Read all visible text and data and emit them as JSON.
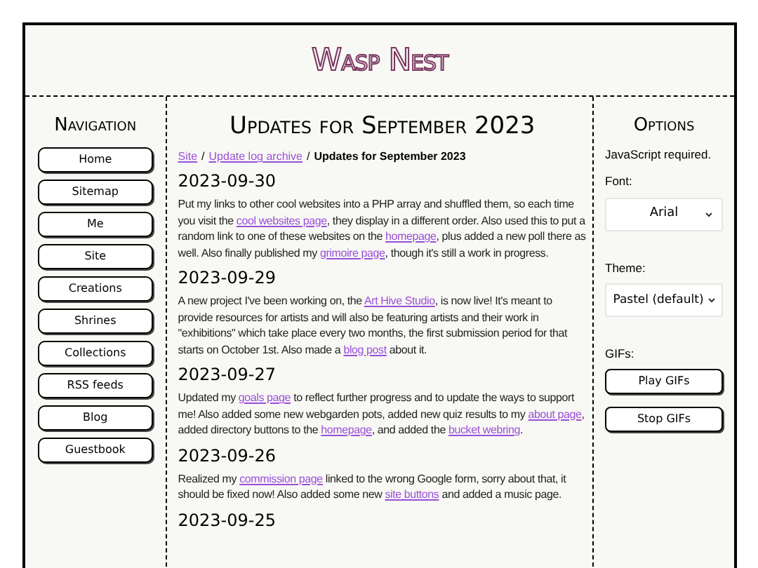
{
  "site_title": "Wasp Nest",
  "navigation": {
    "heading": "Navigation",
    "items": [
      "Home",
      "Sitemap",
      "Me",
      "Site",
      "Creations",
      "Shrines",
      "Collections",
      "RSS feeds",
      "Blog",
      "Guestbook"
    ]
  },
  "main": {
    "heading": "Updates for September 2023",
    "breadcrumb": [
      {
        "kind": "link",
        "text": "Site"
      },
      {
        "kind": "separator",
        "text": "/"
      },
      {
        "kind": "link",
        "text": "Update log archive"
      },
      {
        "kind": "separator",
        "text": "/"
      },
      {
        "kind": "current",
        "text": "Updates for September 2023"
      }
    ],
    "entries": [
      {
        "date": "2023-09-30",
        "body": [
          {
            "t": "Put my links to other cool websites into a PHP array and shuffled them, so each time you visit the "
          },
          {
            "link": "cool websites page"
          },
          {
            "t": ", they display in a different order. Also used this to put a random link to one of these websites on the "
          },
          {
            "link": "homepage"
          },
          {
            "t": ", plus added a new poll there as well. Also finally published my "
          },
          {
            "link": "grimoire page"
          },
          {
            "t": ", though it's still a work in progress."
          }
        ]
      },
      {
        "date": "2023-09-29",
        "body": [
          {
            "t": "A new project I've been working on, the "
          },
          {
            "link": "Art Hive Studio"
          },
          {
            "t": ", is now live! It's meant to provide resources for artists and will also be featuring artists and their work in \"exhibitions\" which take place every two months, the first submission period for that starts on October 1st. Also made a "
          },
          {
            "link": "blog post"
          },
          {
            "t": " about it."
          }
        ]
      },
      {
        "date": "2023-09-27",
        "body": [
          {
            "t": "Updated my "
          },
          {
            "link": "goals page"
          },
          {
            "t": " to reflect further progress and to update the ways to support me! Also added some new webgarden pots, added new quiz results to my "
          },
          {
            "link": "about page"
          },
          {
            "t": ", added directory buttons to the "
          },
          {
            "link": "homepage"
          },
          {
            "t": ", and added the "
          },
          {
            "link": "bucket webring"
          },
          {
            "t": "."
          }
        ]
      },
      {
        "date": "2023-09-26",
        "body": [
          {
            "t": "Realized my "
          },
          {
            "link": "commission page"
          },
          {
            "t": " linked to the wrong Google form, sorry about that, it should be fixed now! Also added some new "
          },
          {
            "link": "site buttons"
          },
          {
            "t": " and added a music page."
          }
        ]
      },
      {
        "date": "2023-09-25"
      }
    ]
  },
  "options": {
    "heading": "Options",
    "note": "JavaScript required.",
    "font_label": "Font:",
    "font_value": "Arial",
    "theme_label": "Theme:",
    "theme_value": "Pastel (default)",
    "gifs_label": "GIFs:",
    "buttons": [
      "Play GIFs",
      "Stop GIFs"
    ]
  }
}
